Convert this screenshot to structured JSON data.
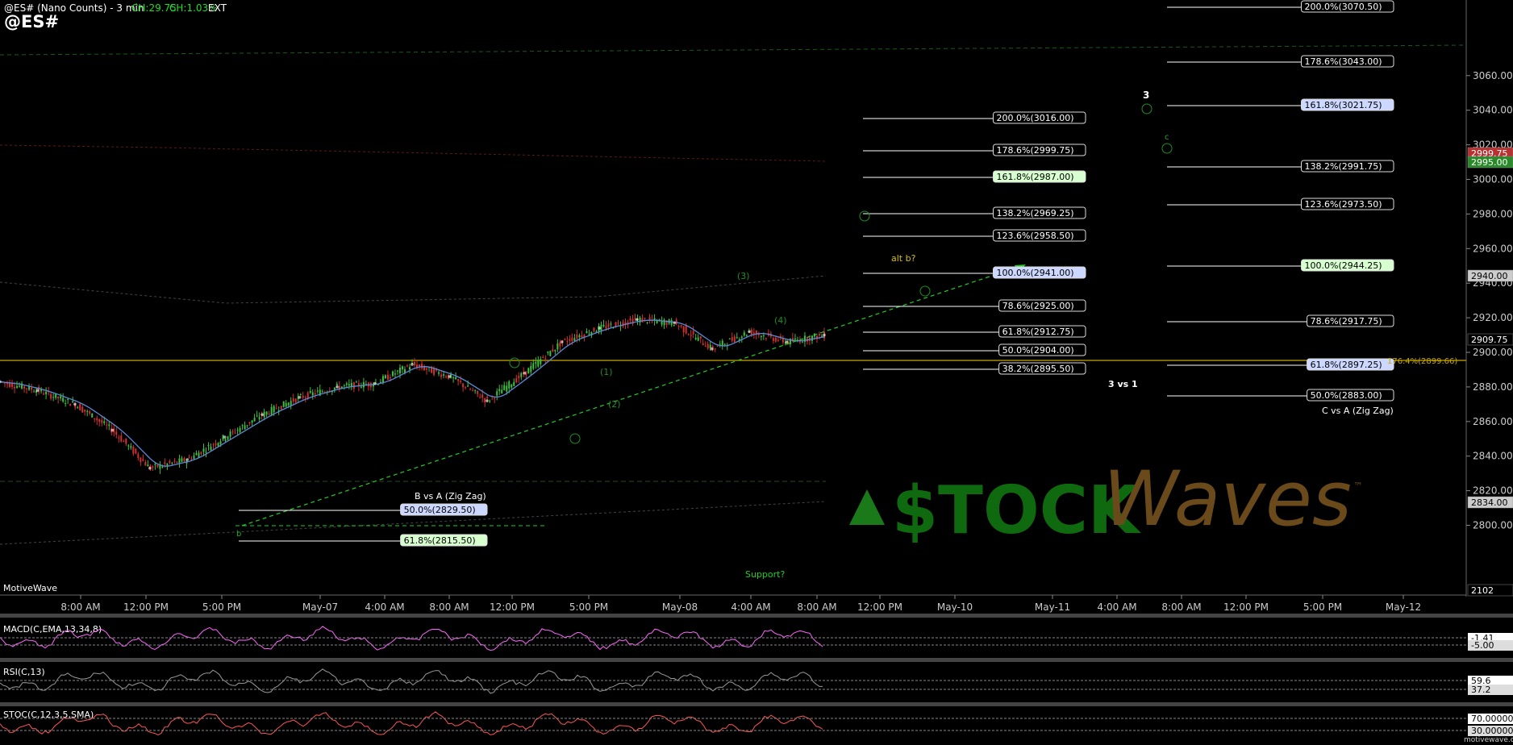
{
  "header": {
    "symbol_line": "@ES# (Nano Counts) - 3 min",
    "change_pts": "CH:29.75",
    "change_pct": "CH:1.03%",
    "session": "EXT",
    "big_symbol": "@ES#"
  },
  "watermark": {
    "stock": "$TOCK",
    "waves": "Waves",
    "tm": "™",
    "footer": "motivewave.com",
    "platform": "MotiveWave"
  },
  "colors": {
    "background": "#000000",
    "candle_up": "#3fbf3f",
    "candle_down": "#d03030",
    "fib_box_highlight": "#ccd8ff",
    "fib_box_green": "#d8ffd0",
    "wave_green": "#1f8f1f",
    "target_line": "#c8a800"
  },
  "price_axis": {
    "ticks": [
      "3060.00",
      "3040.00",
      "3020.00",
      "3000.00",
      "2980.00",
      "2960.00",
      "2940.00",
      "2920.00",
      "2900.00",
      "2880.00",
      "2860.00",
      "2840.00",
      "2820.00",
      "2800.00"
    ],
    "tags": [
      {
        "text": "2999.75",
        "bg": "#b83030",
        "fg": "#ffffff"
      },
      {
        "text": "2995.00",
        "bg": "#2a8a2a",
        "fg": "#ffffff"
      },
      {
        "text": "2940.00",
        "bg": "#cccccc",
        "fg": "#000000"
      },
      {
        "text": "2909.75",
        "bg": "#000000",
        "fg": "#ffffff"
      },
      {
        "text": "2834.00",
        "bg": "#cccccc",
        "fg": "#000000"
      },
      {
        "text": "2102",
        "bg": "#000000",
        "fg": "#ffffff"
      }
    ]
  },
  "time_axis": {
    "labels": [
      "8:00 AM",
      "12:00 PM",
      "5:00 PM",
      "May-07",
      "4:00 AM",
      "8:00 AM",
      "12:00 PM",
      "5:00 PM",
      "May-08",
      "4:00 AM",
      "8:00 AM",
      "12:00 PM",
      "May-10",
      "May-11",
      "4:00 AM",
      "8:00 AM",
      "12:00 PM",
      "5:00 PM",
      "May-12"
    ]
  },
  "fib_labels_left": [
    {
      "text": "50.0%(2829.50)",
      "style": "highlight"
    },
    {
      "text": "61.8%(2815.50)",
      "style": "green"
    }
  ],
  "fib_labels_mid": [
    {
      "text": "200.0%(3016.00)",
      "style": "plain"
    },
    {
      "text": "178.6%(2999.75)",
      "style": "plain"
    },
    {
      "text": "161.8%(2987.00)",
      "style": "green"
    },
    {
      "text": "138.2%(2969.25)",
      "style": "plain"
    },
    {
      "text": "123.6%(2958.50)",
      "style": "plain"
    },
    {
      "text": "100.0%(2941.00)",
      "style": "highlight"
    },
    {
      "text": "78.6%(2925.00)",
      "style": "plain"
    },
    {
      "text": "61.8%(2912.75)",
      "style": "plain"
    },
    {
      "text": "50.0%(2904.00)",
      "style": "plain"
    },
    {
      "text": "38.2%(2895.50)",
      "style": "plain"
    }
  ],
  "fib_labels_right": [
    {
      "text": "200.0%(3070.50)",
      "style": "plain"
    },
    {
      "text": "178.6%(3043.00)",
      "style": "plain"
    },
    {
      "text": "161.8%(3021.75)",
      "style": "highlight"
    },
    {
      "text": "138.2%(2991.75)",
      "style": "plain"
    },
    {
      "text": "123.6%(2973.50)",
      "style": "plain"
    },
    {
      "text": "100.0%(2944.25)",
      "style": "green"
    },
    {
      "text": "78.6%(2917.75)",
      "style": "plain"
    },
    {
      "text": "61.8%(2897.25)",
      "style": "highlight"
    },
    {
      "text": "50.0%(2883.00)",
      "style": "plain"
    }
  ],
  "annotations": {
    "b_vs_a": "B vs A (Zig Zag)",
    "three_vs_one": "3 vs 1",
    "c_vs_a": "C vs A (Zig Zag)",
    "alt_b": "alt b?",
    "support": "Support?",
    "target_line": "176.4%(2899.66)",
    "wave_3": "3",
    "wave_c": "c",
    "wave_b": "b",
    "wave_labels": [
      "(1)",
      "(2)",
      "(3)",
      "(4)"
    ]
  },
  "indicators": {
    "macd": {
      "title": "MACD(C,EMA,13,34,8)",
      "val1": "-1.41",
      "val2": "-5.00"
    },
    "rsi": {
      "title": "RSI(C,13)",
      "val1": "59.6",
      "val2": "37.2"
    },
    "stoch": {
      "title": "STOC(C,12,3,5,SMA)",
      "val1": "70.00000",
      "val2": "30.00000"
    }
  },
  "chart_data": {
    "type": "line",
    "title": "@ES# (Nano Counts) - 3 min",
    "xlabel": "",
    "ylabel": "",
    "ylim": [
      2795,
      3075
    ],
    "x": [
      "8:00 AM",
      "12:00 PM",
      "5:00 PM",
      "May-07",
      "4:00 AM",
      "8:00 AM",
      "12:00 PM",
      "5:00 PM",
      "May-08",
      "4:00 AM",
      "8:00 AM"
    ],
    "series": [
      {
        "values": [
          2883,
          2878,
          2870,
          2855,
          2833,
          2838,
          2851,
          2864,
          2874,
          2880,
          2882,
          2893,
          2886,
          2872,
          2888,
          2906,
          2914,
          2919,
          2917,
          2902,
          2912,
          2906,
          2910
        ]
      }
    ],
    "grid": false,
    "legend": "none"
  }
}
